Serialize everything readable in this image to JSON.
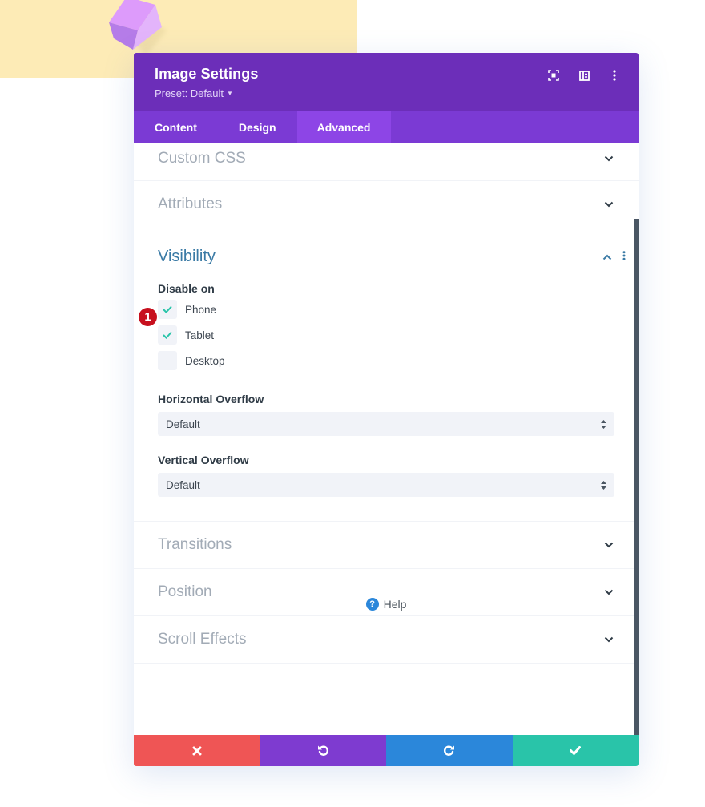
{
  "colors": {
    "header_bg": "#6c2eb9",
    "tabs_bg": "#7b3ad4",
    "tab_active_bg": "#8d45e6",
    "accent_teal": "#29c4a9",
    "section_title_open": "#3a7aa5",
    "section_title": "#a2abb6",
    "cancel": "#ef5555",
    "undo": "#7e3bd0",
    "redo": "#2b87da",
    "save": "#29c4a9",
    "badge": "#c7101e"
  },
  "header": {
    "title": "Image Settings",
    "preset": "Preset: Default",
    "icons": [
      "expand-icon",
      "split-view-icon",
      "more-options-icon"
    ]
  },
  "tabs": [
    {
      "label": "Content",
      "active": false
    },
    {
      "label": "Design",
      "active": false
    },
    {
      "label": "Advanced",
      "active": true
    }
  ],
  "sections_top": [
    {
      "title": "Custom CSS"
    },
    {
      "title": "Attributes"
    }
  ],
  "visibility": {
    "title": "Visibility",
    "disable_on_label": "Disable on",
    "badge": "1",
    "options": [
      {
        "label": "Phone",
        "checked": true
      },
      {
        "label": "Tablet",
        "checked": true
      },
      {
        "label": "Desktop",
        "checked": false
      }
    ],
    "horizontal_overflow": {
      "label": "Horizontal Overflow",
      "value": "Default"
    },
    "vertical_overflow": {
      "label": "Vertical Overflow",
      "value": "Default"
    }
  },
  "sections_bottom": [
    {
      "title": "Transitions"
    },
    {
      "title": "Position"
    },
    {
      "title": "Scroll Effects"
    }
  ],
  "help": {
    "label": "Help",
    "icon": "?"
  },
  "footer": {
    "buttons": [
      "cancel-icon",
      "undo-icon",
      "redo-icon",
      "save-icon"
    ]
  }
}
